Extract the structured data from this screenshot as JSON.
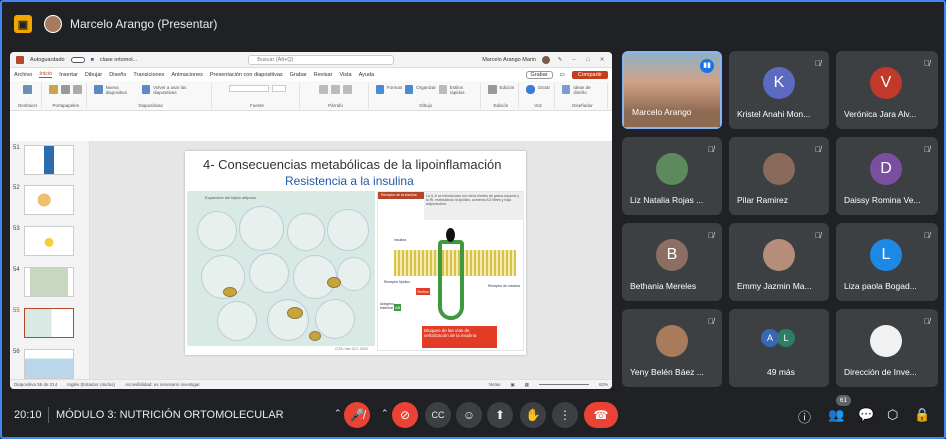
{
  "meeting": {
    "presenter_title": "Marcelo Arango (Presentar)",
    "time": "20:10",
    "name": "MÓDULO 3: NUTRICIÓN ORTOMOLECULAR",
    "participant_count": "61"
  },
  "ppt": {
    "autosave": "Autoguardado",
    "filename": "clase ortomol...",
    "search_placeholder": "Buscar (Alt+Q)",
    "user": "Marcelo Arango Marin",
    "menu": [
      "Archivo",
      "Inicio",
      "Insertar",
      "Dibujar",
      "Diseño",
      "Transiciones",
      "Animaciones",
      "Presentación con diapositivas",
      "Grabar",
      "Revisar",
      "Vista",
      "Ayuda"
    ],
    "grabar_btn": "Grabar",
    "compartir_btn": "Compartir",
    "ribbon_groups": [
      "Deshacer",
      "Portapapeles",
      "Diapositivas",
      "Fuente",
      "Párrafo",
      "Dibujo",
      "Edición",
      "Voz",
      "Diseñador"
    ],
    "ribbon_labels": {
      "nueva": "Nueva diapositiva",
      "volver": "Volver a usar las diapositivas",
      "formas": "Formas",
      "organizar": "Organizar",
      "estilos": "Estilos rápidos",
      "edicion": "Edición",
      "dictar": "Dictar",
      "ideas": "Ideas de diseño"
    },
    "thumb_numbers": [
      "51",
      "52",
      "53",
      "54",
      "55",
      "56"
    ],
    "status_slide": "Diapositiva 55 de 214",
    "status_lang": "Inglés (Estados Unidos)",
    "status_access": "Accesibilidad: es necesario investigar",
    "status_notes": "Notas",
    "status_zoom": "62%"
  },
  "slide": {
    "title": "4- Consecuencias metabólicas de la lipoinflamación",
    "subtitle": "Resistencia a la insulina",
    "left_caption": "Expansión del tejido adiposo",
    "right_caption": "Receptor de la insulina",
    "note": "La IL-6 se introducirán con otros niveles de grasa corporal y la RI, estimulando la lipólisis, aumento AG libres y baja adiponectina",
    "insulina": "Insulina",
    "receptor": "Receptor lipídico",
    "serina": "Serina",
    "ab": "AB",
    "factor": "Antígeno fraternal",
    "sustrato": "Receptor de insulina",
    "bloqueo": "Bloqueo de las vías de señalización de la insulina",
    "source": "CITA: Van GCI, 2003"
  },
  "participants": [
    {
      "name": "Marcelo Arango",
      "speaking": true
    },
    {
      "name": "Kristel Anahi Mon...",
      "initial": "K",
      "color": "#5c6bc0"
    },
    {
      "name": "Verónica Jara Alv...",
      "initial": "V",
      "color": "#c0392b"
    },
    {
      "name": "Liz Natalia Rojas ...",
      "photo": true,
      "color": "#5d8a5d"
    },
    {
      "name": "Pilar Ramirez",
      "photo": true,
      "color": "#8a6a5a"
    },
    {
      "name": "Daissy Romina Ve...",
      "initial": "D",
      "color": "#7b4fa0"
    },
    {
      "name": "Bethania Mereles",
      "initial": "B",
      "color": "#8d6e63"
    },
    {
      "name": "Emmy Jazmin Ma...",
      "photo": true,
      "color": "#b58d7a"
    },
    {
      "name": "Liza paola Bogad...",
      "initial": "L",
      "color": "#1e88e5"
    },
    {
      "name": "Yeny Belén Báez ...",
      "photo": true,
      "color": "#a87b5c"
    },
    {
      "name": "49 más",
      "more": true,
      "a": "A",
      "b": "L"
    },
    {
      "name": "Dirección de Inve...",
      "photo": true,
      "color": "#f1f1f1"
    }
  ],
  "colors": {
    "meet_bg": "#202124",
    "tile": "#3c4043",
    "hangup": "#ea4335",
    "accent": "#8ab4f8"
  }
}
